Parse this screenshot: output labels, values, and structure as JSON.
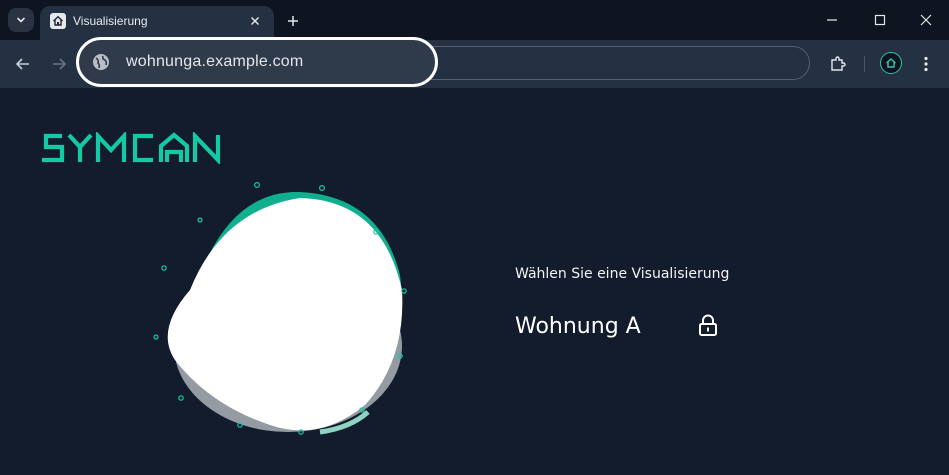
{
  "browser": {
    "tab": {
      "title": "Visualisierung",
      "favicon": "home-icon"
    },
    "url": "wohnunga.example.com",
    "accent": "#2ec4a7"
  },
  "page": {
    "logo_text": "SYMCON",
    "prompt": "Wählen Sie eine Visualisierung",
    "visualizations": [
      {
        "name": "Wohnung A",
        "icon": "lock-icon"
      }
    ],
    "colors": {
      "background": "#131c2c",
      "brand": "#14c9a6"
    }
  }
}
